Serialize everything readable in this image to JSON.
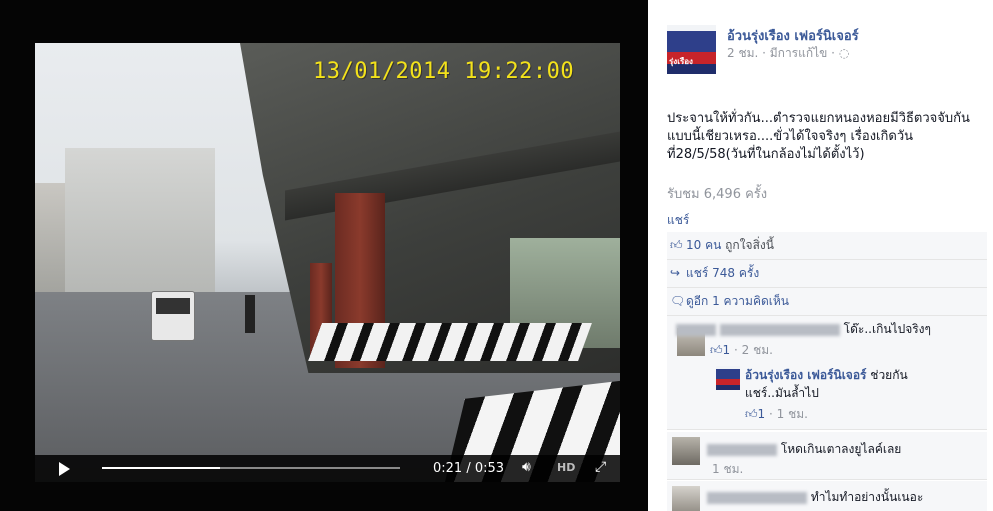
{
  "video": {
    "timestamp": "13/01/2014 19:22:00",
    "current_time": "0:21",
    "duration": "0:53",
    "progress_fraction": 0.396,
    "hd_label": "HD",
    "play_icon": "play-icon",
    "volume_icon": "volume-icon",
    "fullscreen_icon": "fullscreen-icon"
  },
  "close_label": "×",
  "post": {
    "page_name": "อ้วนรุ่งเรือง เฟอร์นิเจอร์",
    "logo_text": "รุ่งเรือง",
    "meta": "2 ชม. · มีการแก้ไข ·",
    "text": "ประจานให้ทั่วกัน...ตำรวจแยกหนองหอยมีวิธีตวจจับกันแบบนี้เชียวเหรอ....ขั่วได้ใจจริงๆ เรื่องเกิดวันที่28/5/58(วันที่ในกล้องไม่ได้ตั้งไว้)",
    "views": "รับชม 6,496 ครั้ง",
    "share_link": "แชร์"
  },
  "stats": {
    "likes_count": "10 คน",
    "likes_text": " ถูกใจสิ่งนี้",
    "shares": "แชร์ 748 ครั้ง",
    "comments": "ดูอีก 1 ความคิดเห็น"
  },
  "comments": [
    {
      "text": "โด๊ะ..เกินไปจริงๆ",
      "likes": "1",
      "time": "2 ชม."
    },
    {
      "name": "อ้วนรุ่งเรือง เฟอร์นิเจอร์",
      "text_line1": " ช่วยกัน",
      "text_line2": "แชร์..มันล้ำไป",
      "likes": "1",
      "time": "1 ชม."
    },
    {
      "text": "โหดเกินเตาลงยูไลค์เลย",
      "time": "1 ชม."
    },
    {
      "text": "ทำไมทำอย่างนั้นเนอะ"
    }
  ]
}
